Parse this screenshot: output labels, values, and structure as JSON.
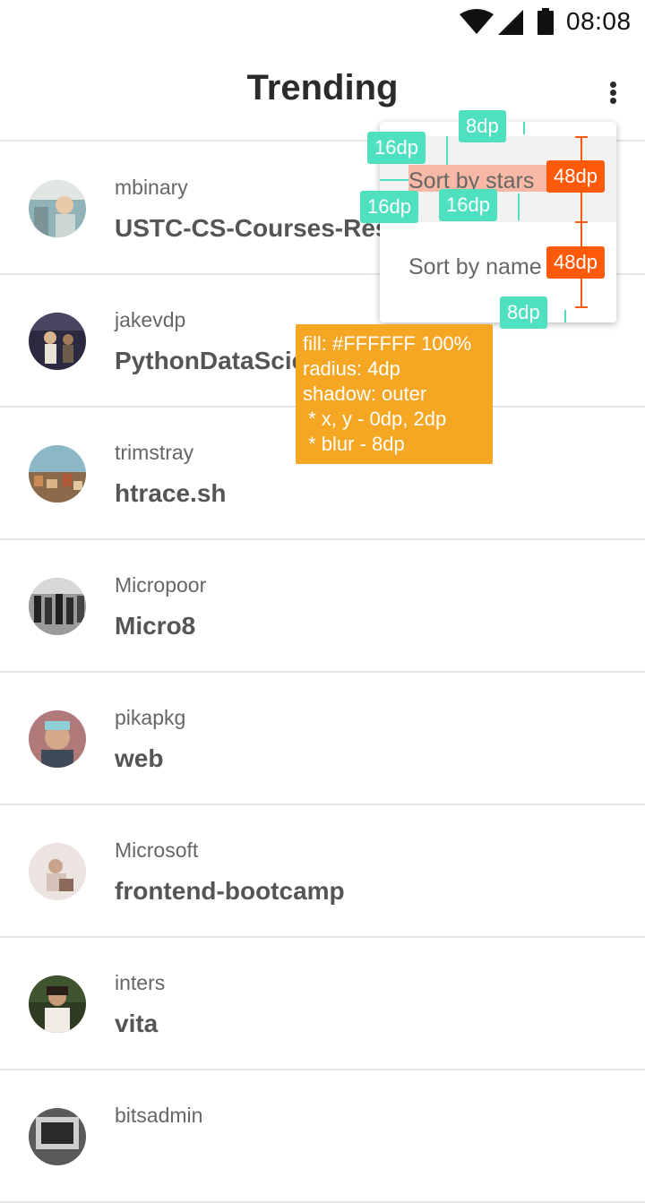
{
  "status_bar": {
    "time": "08:08",
    "icons": [
      "wifi-icon",
      "signal-icon",
      "battery-icon"
    ]
  },
  "app_bar": {
    "title": "Trending",
    "overflow_icon": "more-vert-icon"
  },
  "repos": [
    {
      "owner": "mbinary",
      "name": "USTC-CS-Courses-Resource"
    },
    {
      "owner": "jakevdp",
      "name": "PythonDataScienceHandbook"
    },
    {
      "owner": "trimstray",
      "name": "htrace.sh"
    },
    {
      "owner": "Micropoor",
      "name": "Micro8"
    },
    {
      "owner": "pikapkg",
      "name": "web"
    },
    {
      "owner": "Microsoft",
      "name": "frontend-bootcamp"
    },
    {
      "owner": "inters",
      "name": "vita"
    },
    {
      "owner": "bitsadmin",
      "name": ""
    }
  ],
  "menu": {
    "items": [
      "Sort by stars",
      "Sort by name"
    ],
    "selected": "Sort by stars"
  },
  "annotations": {
    "top_padding": "8dp",
    "left_padding": "16dp",
    "left_padding_2": "16dp",
    "text_gap": "16dp",
    "item_height_1": "48dp",
    "item_height_2": "48dp",
    "bottom_padding": "8dp",
    "spec_lines": [
      "fill: #FFFFFF 100%",
      "radius: 4dp",
      "shadow: outer",
      " * x, y - 0dp, 2dp",
      " * blur - 8dp"
    ]
  },
  "colors": {
    "accent_teal": "#4fe0c0",
    "accent_orange": "#ff5a0a",
    "spec_bg": "#f5a623"
  }
}
